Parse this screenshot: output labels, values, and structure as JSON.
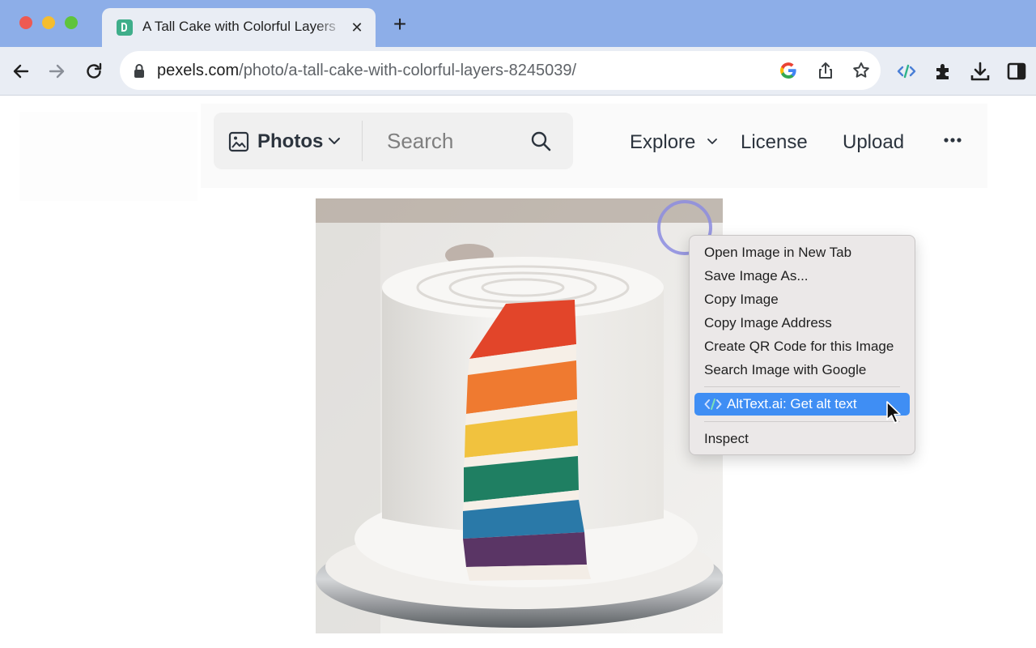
{
  "window": {
    "tab_title": "A Tall Cake with Colorful Layers",
    "tab_close_glyph": "✕",
    "new_tab_glyph": "+"
  },
  "omnibox": {
    "url_host": "pexels.com",
    "url_path": "/photo/a-tall-cake-with-colorful-layers-8245039/"
  },
  "site_header": {
    "media_type": "Photos",
    "search_placeholder": "Search",
    "nav": {
      "explore": "Explore",
      "license": "License",
      "upload": "Upload"
    }
  },
  "context_menu": {
    "items": [
      "Open Image in New Tab",
      "Save Image As...",
      "Copy Image",
      "Copy Image Address",
      "Create QR Code for this Image",
      "Search Image with Google"
    ],
    "extension_item": "AltText.ai: Get alt text",
    "inspect": "Inspect"
  },
  "colors": {
    "titlebar": "#8daee8",
    "toolbar": "#e9edf4",
    "menu_highlight": "#3f8ef4",
    "menu_background": "#ebe8e8"
  }
}
